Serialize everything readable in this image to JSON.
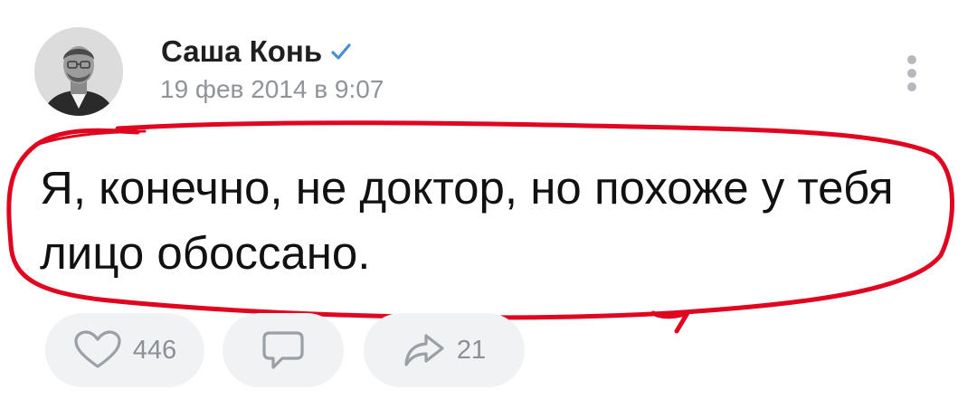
{
  "post": {
    "author_name": "Саша Конь",
    "date": "19 фев 2014 в 9:07",
    "text": "Я, конечно, не доктор, но похоже у тебя лицо обоссано."
  },
  "icons": {
    "verified": "verified-check-icon",
    "more": "more-vertical-icon",
    "like": "heart-icon",
    "comment": "comment-icon",
    "share": "share-icon"
  },
  "actions": {
    "likes_count": "446",
    "shares_count": "21"
  },
  "colors": {
    "text": "#111111",
    "secondary": "#8f949a",
    "verified": "#4a8fd6",
    "scribble": "#e0061f",
    "action_bg": "#f1f2f4"
  }
}
